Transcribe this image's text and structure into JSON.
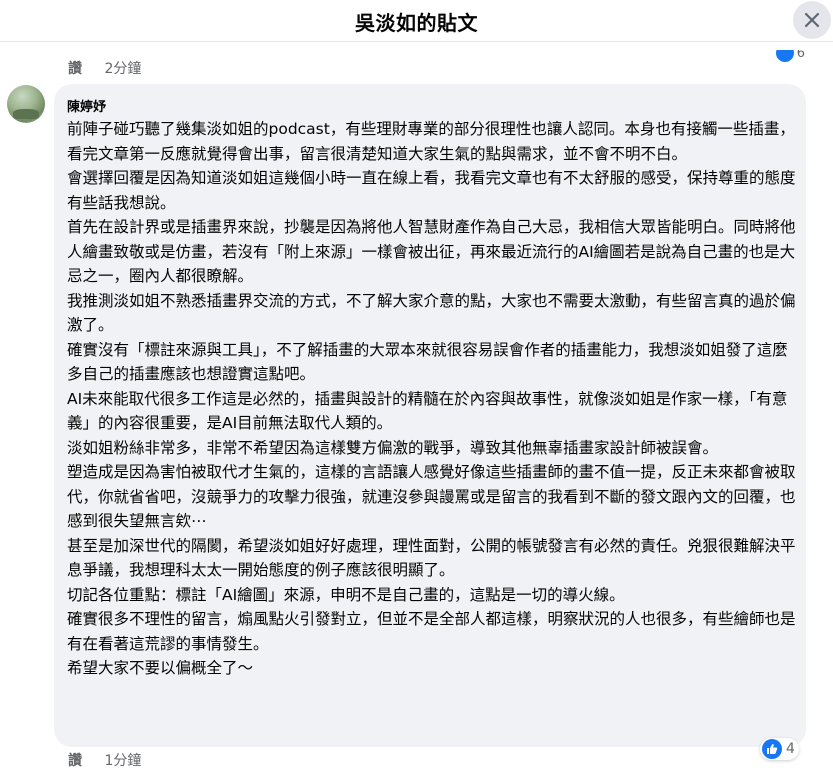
{
  "header": {
    "title": "吳淡如的貼文",
    "close_icon": "close-icon"
  },
  "previous_comment": {
    "like_label": "讚",
    "time": "2分鐘",
    "reaction_count": "6"
  },
  "comment": {
    "author": "陳婷妤",
    "paragraphs": [
      "前陣子碰巧聽了幾集淡如姐的podcast，有些理財專業的部分很理性也讓人認同。本身也有接觸一些插畫，看完文章第一反應就覺得會出事，留言很清楚知道大家生氣的點與需求，並不會不明不白。",
      "會選擇回覆是因為知道淡如姐這幾個小時一直在線上看，我看完文章也有不太舒服的感受，保持尊重的態度有些話我想說。",
      "首先在設計界或是插畫界來說，抄襲是因為將他人智慧財產作為自己大忌，我相信大眾皆能明白。同時將他人繪畫致敬或是仿畫，若沒有「附上來源」一樣會被出征，再來最近流行的AI繪圖若是說為自己畫的也是大忌之一，圈內人都很瞭解。",
      "我推測淡如姐不熟悉插畫界交流的方式，不了解大家介意的點，大家也不需要太激動，有些留言真的過於偏激了。",
      "確實沒有「標註來源與工具」，不了解插畫的大眾本來就很容易誤會作者的插畫能力，我想淡如姐發了這麼多自己的插畫應該也想證實這點吧。",
      "AI未來能取代很多工作這是必然的，插畫與設計的精髓在於內容與故事性，就像淡如姐是作家一樣，「有意義」的內容很重要，是AI目前無法取代人類的。",
      "淡如姐粉絲非常多，非常不希望因為這樣雙方偏激的戰爭，導致其他無辜插畫家設計師被誤會。",
      "塑造成是因為害怕被取代才生氣的，這樣的言語讓人感覺好像這些插畫師的畫不值一提，反正未來都會被取代，你就省省吧，沒競爭力的攻擊力很強，就連沒參與謾罵或是留言的我看到不斷的發文跟內文的回覆，也感到很失望無言欸⋯",
      "甚至是加深世代的隔閡，希望淡如姐好好處理，理性面對，公開的帳號發言有必然的責任。兇狠很難解決平息爭議，我想理科太太一開始態度的例子應該很明顯了。",
      "切記各位重點：標註「AI繪圖」來源，申明不是自己畫的，這點是一切的導火線。",
      "確實很多不理性的留言，煽風點火引發對立，但並不是全部人都這樣，明察狀況的人也很多，有些繪師也是有在看著這荒謬的事情發生。",
      "希望大家不要以偏概全了～"
    ],
    "like_label": "讚",
    "time": "1分鐘",
    "reaction_count": "4"
  },
  "colors": {
    "accent": "#1877f2",
    "bubble_bg": "#f0f2f5",
    "secondary_text": "#65676b"
  }
}
